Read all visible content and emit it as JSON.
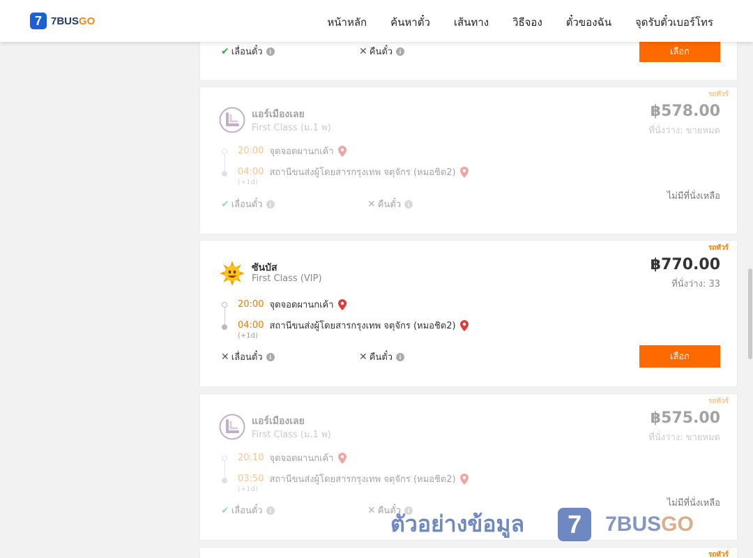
{
  "brand": {
    "mark": "7",
    "name_main": "7BUS",
    "name_accent": "GO"
  },
  "nav": [
    "หน้าหลัก",
    "ค้นหาตั๋ว",
    "เส้นทาง",
    "วิธีจอง",
    "ตั๋วของฉัน",
    "จุดรับตั๋วเบอร์โทร"
  ],
  "labels": {
    "reschedule": "เลื่อนตั๋ว",
    "refund": "คืนตั๋ว",
    "select": "เลือก",
    "no_seats": "ไม่มีที่นั่งเหลือ",
    "plus1": "(+1d)",
    "tag": "รถทัวร์",
    "info": "i"
  },
  "top_card": {
    "reschedule_allowed": true,
    "refund_allowed": false
  },
  "trips": [
    {
      "operator": "แอร์เมืองเลย",
      "class": "First Class (ม.1 พ)",
      "price": "฿578.00",
      "seats": "ที่นั่งว่าง: ขายหมด",
      "depart_time": "20:00",
      "depart_place": "จุดจอดผานกเค้า",
      "arrive_time": "04:00",
      "arrive_place": "สถานีขนส่งผู้โดยสารกรุงเทพ จตุจักร (หมอชิต2)",
      "reschedule_allowed": true,
      "refund_allowed": false,
      "available": false,
      "logo": "airmuanglei-logo"
    },
    {
      "operator": "ซันบัส",
      "class": "First Class (VIP)",
      "price": "฿770.00",
      "seats": "ที่นั่งว่าง: 33",
      "depart_time": "20:00",
      "depart_place": "จุดจอดผานกเค้า",
      "arrive_time": "04:00",
      "arrive_place": "สถานีขนส่งผู้โดยสารกรุงเทพ จตุจักร (หมอชิต2)",
      "reschedule_allowed": false,
      "refund_allowed": false,
      "available": true,
      "logo": "sunbus-logo"
    },
    {
      "operator": "แอร์เมืองเลย",
      "class": "First Class (ม.1 พ)",
      "price": "฿575.00",
      "seats": "ที่นั่งว่าง: ขายหมด",
      "depart_time": "20:10",
      "depart_place": "จุดจอดผานกเค้า",
      "arrive_time": "03:50",
      "arrive_place": "สถานีขนส่งผู้โดยสารกรุงเทพ จตุจักร (หมอชิต2)",
      "reschedule_allowed": true,
      "refund_allowed": false,
      "available": false,
      "logo": "airmuanglei-logo"
    }
  ],
  "watermark": {
    "text": "ตัวอย่างข้อมูล",
    "mark": "7",
    "brand_main": "7BUS",
    "brand_accent": "GO"
  },
  "colors": {
    "accent": "#ff6a00",
    "time": "#ee7a00",
    "brand_blue": "#1e5fd8",
    "check": "#2fa84f"
  }
}
